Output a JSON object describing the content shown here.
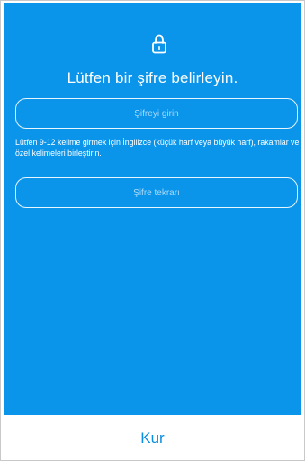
{
  "title": "Lütfen bir şifre belirleyin.",
  "password_input": {
    "value": "",
    "placeholder": "Şifreyi girin"
  },
  "hint_text": "Lütfen 9-12 kelime girmek için İngilizce (küçük harf veya büyük harf), rakamlar ve özel kelimeleri birleştirin.",
  "confirm_input": {
    "value": "",
    "placeholder": "Şifre tekrarı"
  },
  "footer": {
    "setup_label": "Kur"
  },
  "icons": {
    "top_icon": "lock-icon"
  },
  "colors": {
    "panel": "#0a94ea",
    "accent": "#0a8ee0",
    "text_on_panel": "#ffffff"
  }
}
